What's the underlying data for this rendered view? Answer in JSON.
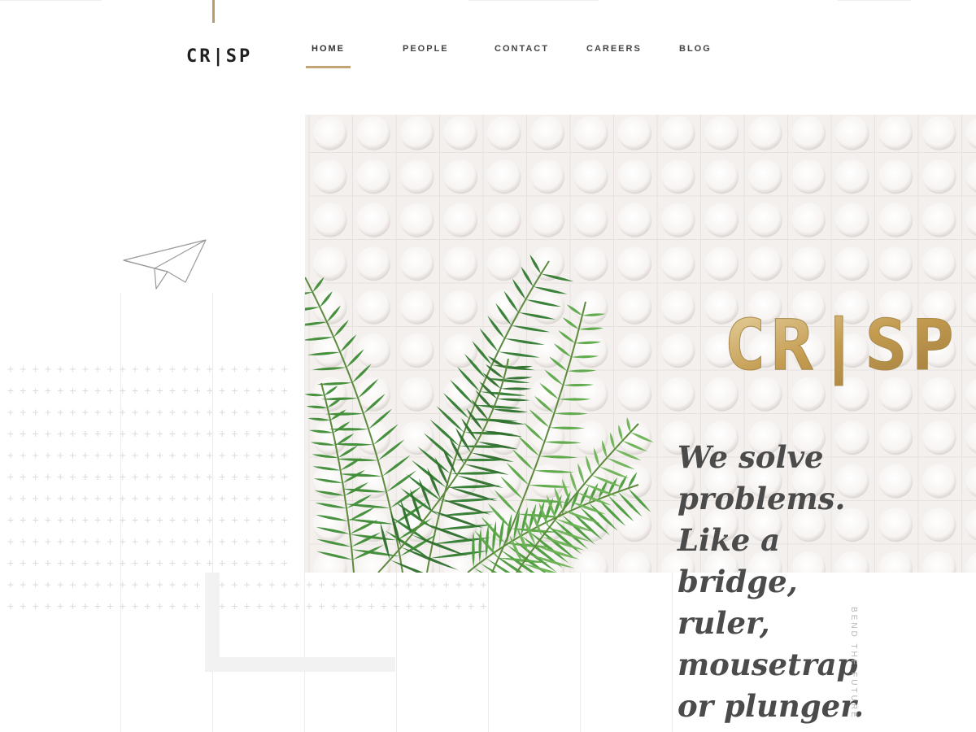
{
  "brand": {
    "logo_text": "CR|SP",
    "accent_color": "#c3a477"
  },
  "nav": {
    "items": [
      {
        "label": "HOME",
        "active": true
      },
      {
        "label": "PEOPLE",
        "active": false
      },
      {
        "label": "CONTACT",
        "active": false
      },
      {
        "label": "CAREERS",
        "active": false
      },
      {
        "label": "BLOG",
        "active": false
      }
    ]
  },
  "hero": {
    "sign_text": "CR|SP",
    "headline_lines": [
      "We solve",
      "problems.",
      "Like a",
      "bridge,",
      "ruler,",
      "mousetrap",
      "or plunger."
    ],
    "tagline": "BEND THE FUTURE"
  },
  "icons": {
    "decoration": "paper-plane-icon"
  }
}
